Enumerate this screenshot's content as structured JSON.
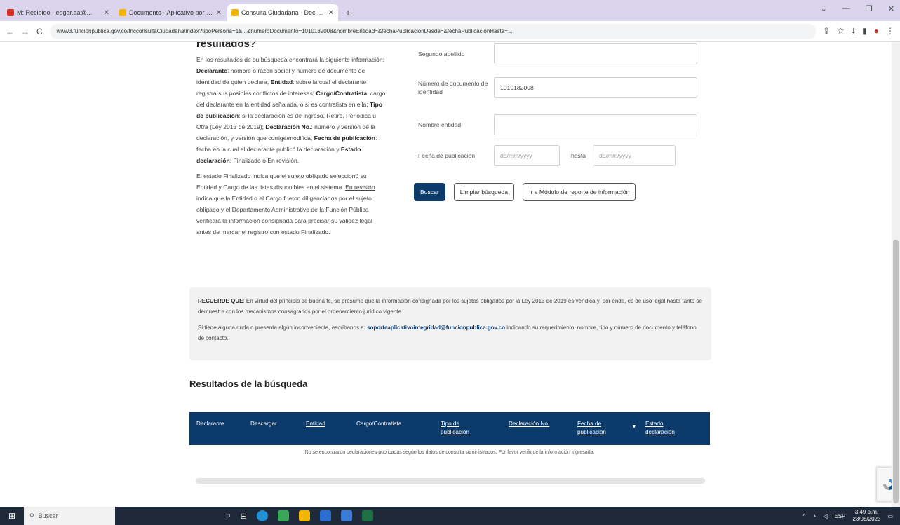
{
  "browser": {
    "tabs": [
      {
        "title": "M: Recibido - edgar.aa@...",
        "fav": "#d93025",
        "active": false
      },
      {
        "title": "Documento - Aplicativo por la I...",
        "fav": "#f4b400",
        "active": false
      },
      {
        "title": "Consulta Ciudadana - Declara...",
        "fav": "#f4b400",
        "active": true
      }
    ],
    "url": "www3.funcionpublica.gov.co/fncconsultaCiudadana/index?tipoPersona=1&...&numeroDocumento=1010182008&nombreEntidad=&fechaPublicacionDesde=&fechaPublicacionHasta=...",
    "new_tab": "+",
    "back": "←",
    "forward": "→",
    "reload": "C"
  },
  "left": {
    "title": "resultados?",
    "p1": [
      {
        "t": "En los resultados de su búsqueda encontrará la siguiente información: ",
        "b": false
      },
      {
        "t": "Declarante",
        "b": true
      },
      {
        "t": ": nombre o razón social y número de documento de identidad de quien declara; ",
        "b": false
      },
      {
        "t": "Entidad",
        "b": true
      },
      {
        "t": ": sobre la cual el declarante registra sus posibles conflictos de intereses; ",
        "b": false
      },
      {
        "t": "Cargo/Contratista",
        "b": true
      },
      {
        "t": ": cargo del declarante en la entidad señalada, o si es contratista en ella; ",
        "b": false
      },
      {
        "t": "Tipo de publicación",
        "b": true
      },
      {
        "t": ": si la declaración es de ingreso, Retiro, Periódica u Otra (Ley 2013 de 2019); ",
        "b": false
      },
      {
        "t": "Declaración No.",
        "b": true
      },
      {
        "t": ": número y versión de la declaración, y versión que corrige/modifica; ",
        "b": false
      },
      {
        "t": "Fecha de publicación",
        "b": true
      },
      {
        "t": ": fecha en la cual el declarante publicó la declaración y ",
        "b": false
      },
      {
        "t": "Estado declaración",
        "b": true
      },
      {
        "t": ": Finalizado o En revisión.",
        "b": false
      }
    ],
    "p2_a": "El estado ",
    "p2_finalizado": "Finalizado",
    "p2_b": " indica que el sujeto obligado seleccionó su Entidad y Cargo de las listas disponibles en el sistema. ",
    "p2_enrevision": "En revisión",
    "p2_c": " indica que la Entidad o el Cargo fueron diligenciados por el sujeto obligado y el Departamento Administrativo de la Función Pública verificará la información consignada para precisar su validez legal antes de marcar el registro con estado Finalizado."
  },
  "form": {
    "segundo_apellido_label": "Segundo apellido",
    "segundo_apellido_value": "",
    "num_doc_label": "Número de documento de identidad",
    "num_doc_value": "1010182008",
    "entidad_label": "Nombre entidad",
    "entidad_value": "",
    "fecha_label": "Fecha de publicación",
    "fecha_desde_placeholder": "dd/mm/yyyy",
    "hasta_label": "hasta",
    "fecha_hasta_placeholder": "dd/mm/yyyy"
  },
  "buttons": {
    "buscar": "Buscar",
    "limpiar": "Limpiar búsqueda",
    "modulo": "Ir a Módulo de reporte de información"
  },
  "notice": {
    "recuerde": "RECUERDE QUE",
    "p1": ": En virtud del principio de buena fe, se presume que la información consignada por los sujetos obligados por la Ley 2013 de 2019 es verídica y, por ende, es de uso legal hasta tanto se demuestre con los mecanismos consagrados por el ordenamiento jurídico vigente.",
    "p2_a": "Si tiene alguna duda o presenta algún inconveniente, escríbanos a: ",
    "email": "soporteaplicativointegridad@funcionpublica.gov.co",
    "p2_b": " indicando su requerimiento, nombre, tipo y número de documento y teléfono de contacto."
  },
  "results": {
    "title": "Resultados de la búsqueda",
    "columns": [
      "Declarante",
      "Descargar",
      "Entidad",
      "Cargo/Contratista",
      "Tipo de publicación",
      "Declaración No.",
      "Fecha de publicación",
      "Estado declaración"
    ],
    "sort_arrow": "▾",
    "empty": "No se encontraron declaraciones publicadas según los datos de consulta suministrados. Por favor verifique la información ingresada."
  },
  "taskbar": {
    "search_placeholder": "Buscar",
    "time": "3:49 p.m.",
    "date": "23/08/2023",
    "lang": "ESP"
  },
  "colors": {
    "primary": "#0b3a6b",
    "tabbar": "#dad5ec"
  }
}
